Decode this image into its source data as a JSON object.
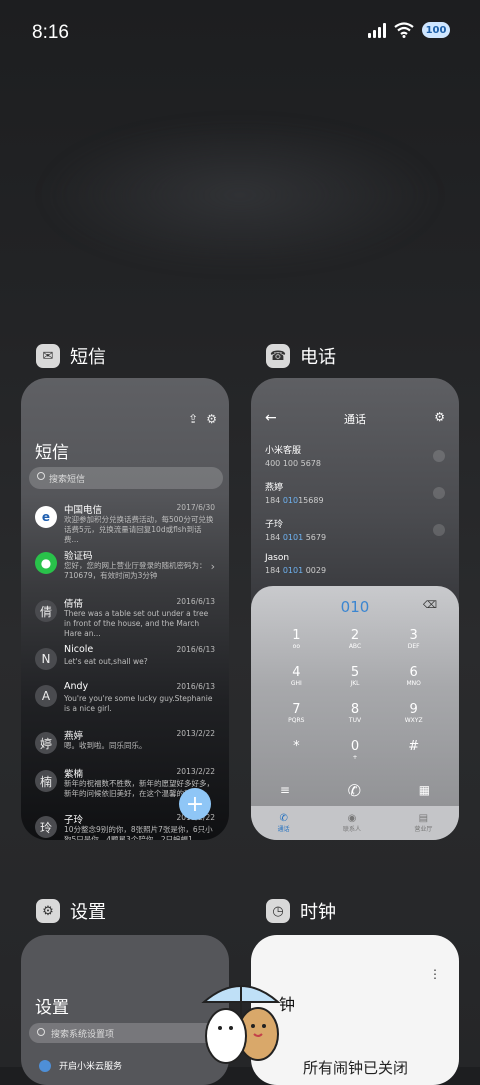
{
  "status": {
    "time": "8:16",
    "battery": "100"
  },
  "apps": {
    "sms": {
      "name": "短信",
      "title": "短信",
      "search_placeholder": "搜索短信",
      "messages": [
        {
          "avatar": "",
          "name": "中国电信",
          "date": "2017/6/30",
          "text": "欢迎参加积分兑换话费活动，每500分可兑换话费5元，兑换流量请回复10d或flsh到话费..."
        },
        {
          "avatar": "",
          "name": "验证码",
          "date": "",
          "text": "您好，您的网上营业厅登录的随机密码为：710679，有效时间为3分钟"
        },
        {
          "avatar": "倩",
          "name": "倩倩",
          "date": "2016/6/13",
          "text": "There was a table set out under a tree in front of the house, and the March Hare an..."
        },
        {
          "avatar": "N",
          "name": "Nicole",
          "date": "2016/6/13",
          "text": "Let's eat out,shall we?"
        },
        {
          "avatar": "A",
          "name": "Andy",
          "date": "2016/6/13",
          "text": "You're you're some lucky guy.Stephanie is a nice girl."
        },
        {
          "avatar": "婷",
          "name": "燕婷",
          "date": "2013/2/22",
          "text": "嗯。收到啦。同乐同乐。"
        },
        {
          "avatar": "楠",
          "name": "紫楠",
          "date": "2013/2/22",
          "text": "新年的祝福数不胜数，新年的愿望好多好多，新年的问候依旧美好，在这个温馨的新年..."
        },
        {
          "avatar": "玲",
          "name": "子玲",
          "date": "2013/2/22",
          "text": "10分整念9别的你，8张照片7张是你，6只小狗5只是你，4颗星3个陪你，2只蝙蝠1..."
        }
      ]
    },
    "phone": {
      "name": "电话",
      "title": "通话",
      "contacts": [
        {
          "name": "小米客服",
          "pre": "400 100 5678",
          "hl": "",
          "post": ""
        },
        {
          "name": "燕婷",
          "pre": "184 ",
          "hl": "010",
          "post": "15689"
        },
        {
          "name": "子玲",
          "pre": "184 ",
          "hl": "0101",
          "post": " 5679"
        },
        {
          "name": "Jason",
          "pre": "184 ",
          "hl": "0101",
          "post": " 0029"
        }
      ],
      "dial_number": "010",
      "keys": [
        {
          "k": "1",
          "s": "oo"
        },
        {
          "k": "2",
          "s": "ABC"
        },
        {
          "k": "3",
          "s": "DEF"
        },
        {
          "k": "4",
          "s": "GHI"
        },
        {
          "k": "5",
          "s": "JKL"
        },
        {
          "k": "6",
          "s": "MNO"
        },
        {
          "k": "7",
          "s": "PQRS"
        },
        {
          "k": "8",
          "s": "TUV"
        },
        {
          "k": "9",
          "s": "WXYZ"
        },
        {
          "k": "*",
          "s": ""
        },
        {
          "k": "0",
          "s": "+"
        },
        {
          "k": "#",
          "s": ""
        }
      ],
      "tabs": [
        "通话",
        "联系人",
        "营业厅"
      ]
    },
    "settings": {
      "name": "设置",
      "title": "设置",
      "search_placeholder": "搜索系统设置项",
      "first_item": "开启小米云服务"
    },
    "clock": {
      "name": "时钟",
      "title": "钟",
      "note": "所有闹钟已关闭"
    }
  },
  "colors": {
    "accent": "#3b86d1",
    "fab": "#8fc6f6",
    "highlight": "#6fb3f2"
  }
}
